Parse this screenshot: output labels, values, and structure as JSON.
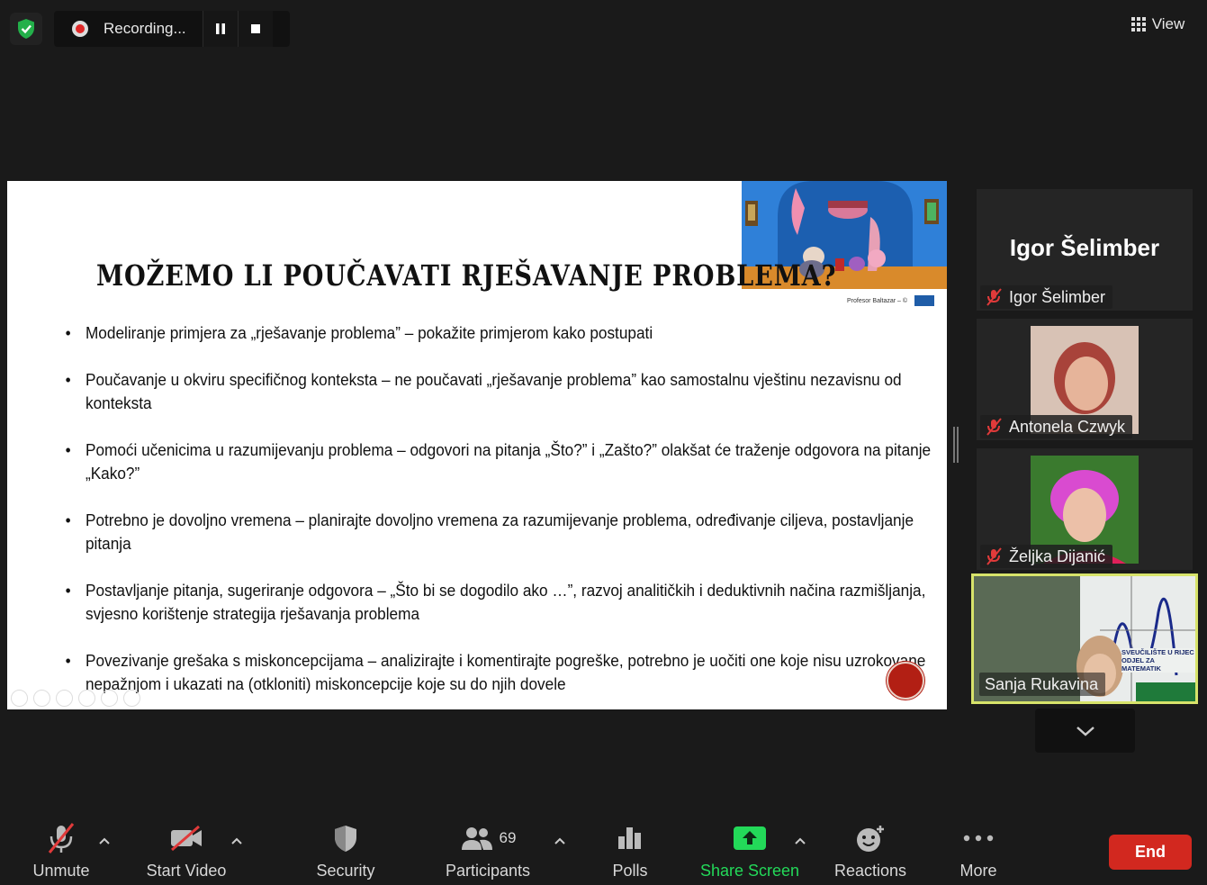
{
  "top": {
    "recording_label": "Recording...",
    "view_label": "View"
  },
  "slide": {
    "title": "MOŽEMO LI POUČAVATI RJEŠAVANJE PROBLEMA?",
    "image_credit": "Profesor Baltazar – ©",
    "bullets": [
      "Modeliranje primjera za „rješavanje problema” – pokažite primjerom kako postupati",
      "Poučavanje u okviru specifičnog konteksta – ne poučavati „rješavanje problema” kao samostalnu vještinu nezavisnu od konteksta",
      "Pomoći učenicima u razumijevanju problema – odgovori na pitanja „Što?” i „Zašto?” olakšat će traženje odgovora na pitanje „Kako?”",
      "Potrebno je dovoljno vremena – planirajte dovoljno vremena za razumijevanje problema, određivanje ciljeva, postavljanje pitanja",
      "Postavljanje pitanja, sugeriranje odgovora – „Što bi se dogodilo ako …”, razvoj analitičkih i deduktivnih načina razmišljanja, svjesno korištenje strategija rješavanja problema",
      "Povezivanje grešaka s miskoncepcijama –  analizirajte i komentirajte pogreške, potrebno je uočiti one koje nisu uzrokovane nepažnjom i ukazati na (otkloniti) miskoncepcije koje su do njih dovele"
    ]
  },
  "participants": [
    {
      "name": "Igor Šelimber",
      "big_label": "Igor Šelimber",
      "muted": true
    },
    {
      "name": "Antonela Czwyk",
      "muted": true
    },
    {
      "name": "Željka Dijanić",
      "muted": true
    },
    {
      "name": "Sanja Rukavina",
      "muted": false,
      "active_speaker": true
    }
  ],
  "active_banner": {
    "line1": "SVEUČILIŠTE U RIJEC",
    "line2": "ODJEL ZA MATEMATIK"
  },
  "toolbar": {
    "unmute": "Unmute",
    "start_video": "Start Video",
    "security": "Security",
    "participants": "Participants",
    "participants_count": "69",
    "polls": "Polls",
    "share_screen": "Share Screen",
    "reactions": "Reactions",
    "more": "More",
    "end": "End"
  },
  "colors": {
    "share_green": "#23d959",
    "end_red": "#d2281f",
    "muted_red": "#e03a3a",
    "active_border": "#d7e36a"
  }
}
